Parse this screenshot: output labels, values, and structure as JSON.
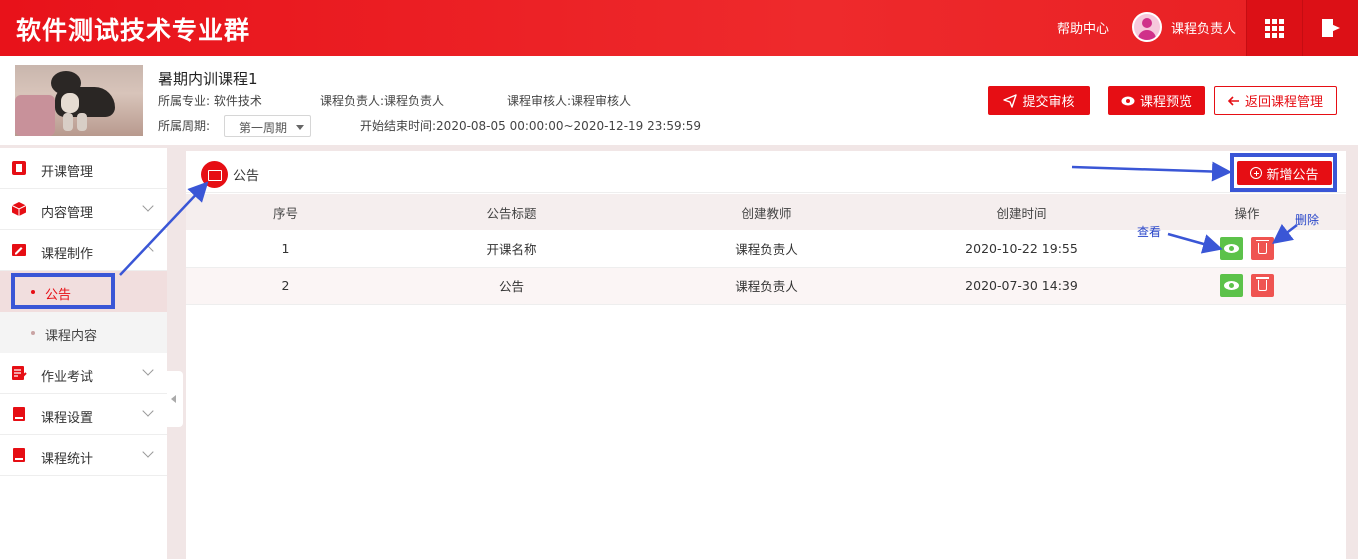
{
  "topbar": {
    "brand": "软件测试技术专业群",
    "help_label": "帮助中心",
    "username": "课程负责人",
    "grid_icon": "apps-grid-icon",
    "logout_icon": "logout-icon"
  },
  "course": {
    "title": "暑期内训课程1",
    "major_label": "所属专业:",
    "major_value": "软件技术",
    "owner_label": "课程负责人:",
    "owner_value": "课程负责人",
    "reviewer_label": "课程审核人:",
    "reviewer_value": "课程审核人",
    "period_label": "所属周期:",
    "period_value": "第一周期",
    "time_label": "开始结束时间:",
    "time_value": "2020-08-05 00:00:00~2020-12-19 23:59:59"
  },
  "actions": {
    "submit_review": "提交审核",
    "preview": "课程预览",
    "back": "返回课程管理"
  },
  "sidebar": {
    "items": [
      {
        "label": "开课管理"
      },
      {
        "label": "内容管理"
      },
      {
        "label": "课程制作"
      },
      {
        "label": "作业考试"
      },
      {
        "label": "课程设置"
      },
      {
        "label": "课程统计"
      }
    ],
    "sub_items": [
      {
        "label": "公告",
        "active": true
      },
      {
        "label": "课程内容",
        "active": false
      }
    ]
  },
  "panel": {
    "title": "公告",
    "add_button": "新增公告",
    "columns": [
      "序号",
      "公告标题",
      "创建教师",
      "创建时间",
      "操作"
    ],
    "rows": [
      {
        "index": "1",
        "title": "开课名称",
        "teacher": "课程负责人",
        "created": "2020-10-22 19:55"
      },
      {
        "index": "2",
        "title": "公告",
        "teacher": "课程负责人",
        "created": "2020-07-30 14:39"
      }
    ]
  },
  "annotations": {
    "view": "查看",
    "delete": "删除",
    "highlight_color": "#3a56d6"
  },
  "colors": {
    "primary": "#e60e14",
    "view_green": "#5cc24a",
    "delete_red": "#ef5451"
  }
}
